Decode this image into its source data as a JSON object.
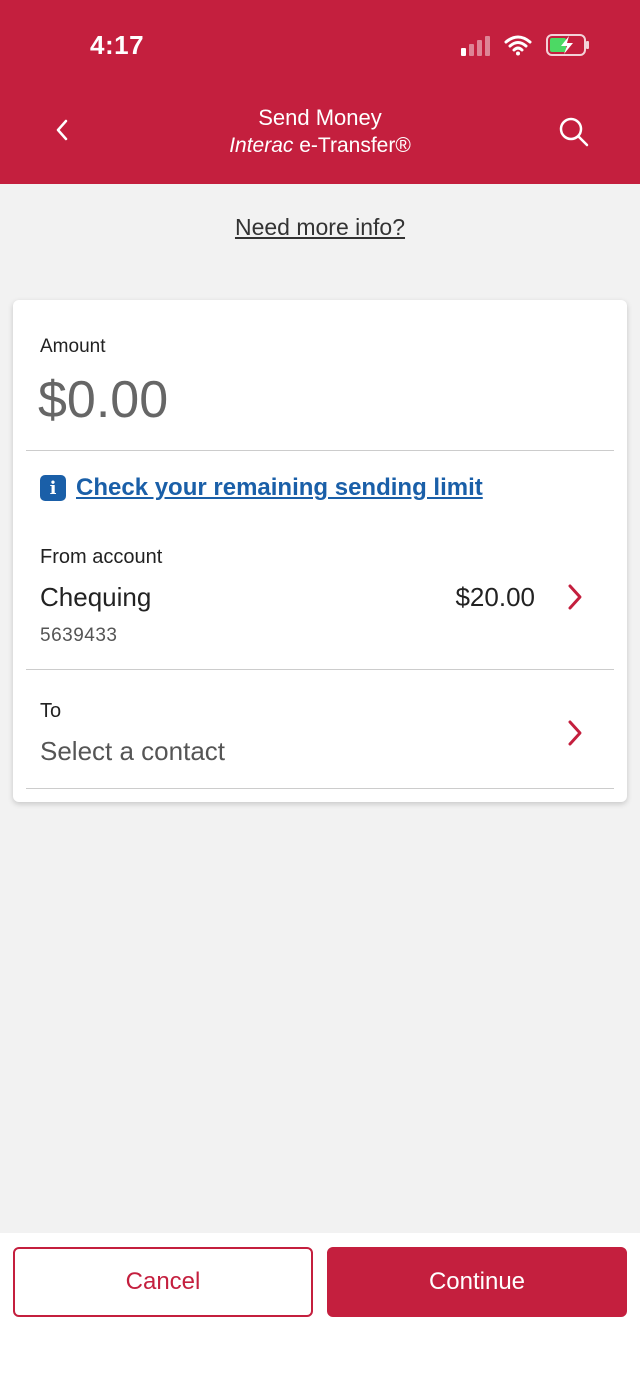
{
  "colors": {
    "brand": "#c41f3e",
    "link_blue": "#1a5fa8",
    "battery_green": "#4cd964"
  },
  "status_bar": {
    "time": "4:17",
    "icons": [
      "signal-icon",
      "wifi-icon",
      "battery-charging-icon"
    ]
  },
  "header": {
    "title": "Send Money",
    "subtitle_brand": "Interac",
    "subtitle_rest": " e-Transfer®",
    "back_icon": "chevron-left-icon",
    "search_icon": "search-icon"
  },
  "info_link": "Need more info?",
  "form": {
    "amount_label": "Amount",
    "amount_value": "$0.00",
    "limit_link": "Check your remaining sending limit",
    "from": {
      "label": "From account",
      "account_name": "Chequing",
      "account_number": "5639433",
      "balance": "$20.00"
    },
    "to": {
      "label": "To",
      "placeholder": "Select a contact"
    }
  },
  "footer": {
    "cancel_label": "Cancel",
    "continue_label": "Continue"
  }
}
